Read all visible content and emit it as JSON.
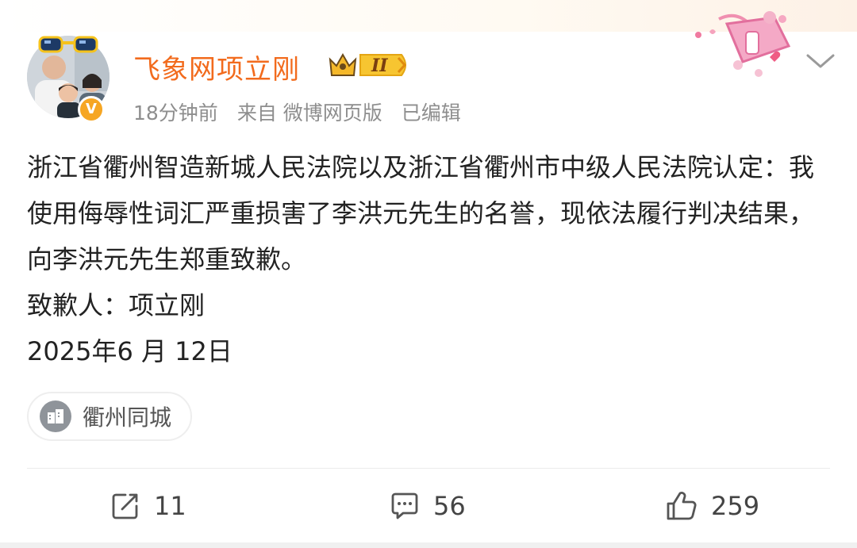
{
  "header": {
    "username": "飞象网项立刚",
    "badge_level": "II",
    "meta": {
      "time": "18分钟前",
      "source": "来自 微博网页版",
      "edited": "已编辑"
    }
  },
  "post": {
    "paragraphs": [
      "浙江省衢州智造新城人民法院以及浙江省衢州市中级人民法院认定：我使用侮辱性词汇严重损害了李洪元先生的名誉，现依法履行判决结果，向李洪元先生郑重致歉。",
      "致歉人：项立刚",
      "2025年6 月 12日"
    ],
    "location": "衢州同城"
  },
  "actions": {
    "repost_count": "11",
    "comment_count": "56",
    "like_count": "259"
  },
  "icons": {
    "avatar_verified": "verified-v-icon",
    "more": "chevron-down-icon",
    "location": "building-icon",
    "repost": "repost-icon",
    "comment": "comment-icon",
    "like": "thumbs-up-icon"
  },
  "colors": {
    "username": "#f26b1d",
    "meta": "#8e8e8e",
    "verified": "#f6a623"
  }
}
